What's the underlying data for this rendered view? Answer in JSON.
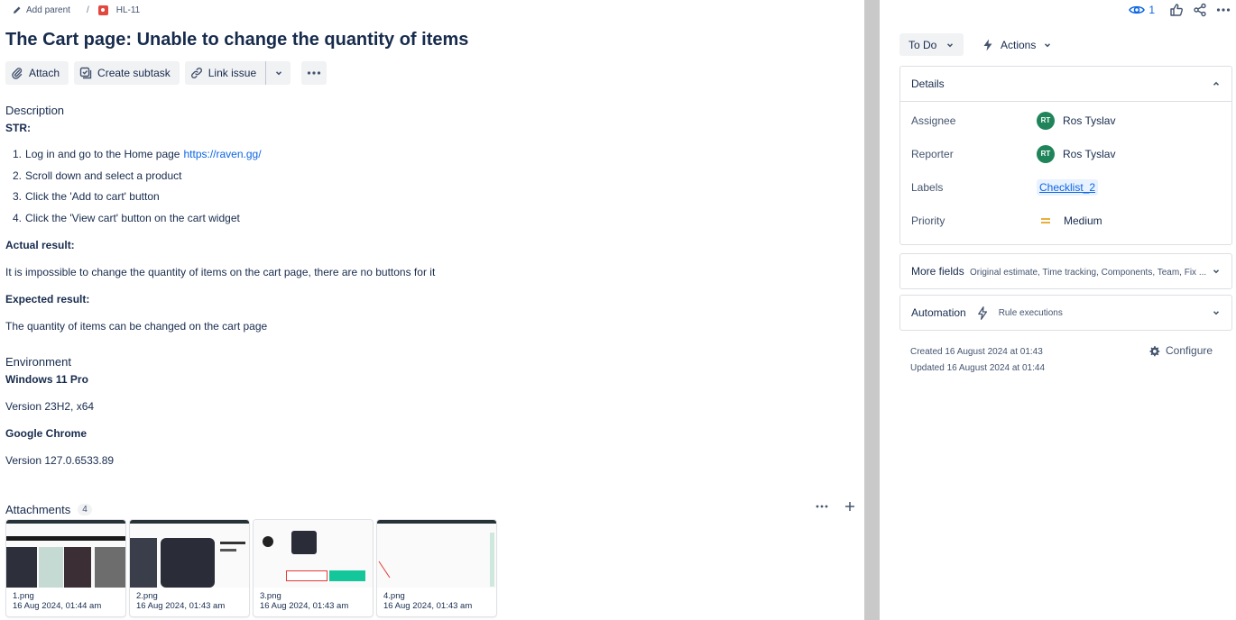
{
  "breadcrumb": {
    "add_parent": "Add parent",
    "separator": "/",
    "issue_key": "HL-11"
  },
  "issue": {
    "title": "The Cart page: Unable to change the quantity of items"
  },
  "toolbar": {
    "attach": "Attach",
    "create_subtask": "Create subtask",
    "link_issue": "Link issue"
  },
  "description": {
    "heading": "Description",
    "str_label": "STR:",
    "steps": [
      {
        "num": "1.",
        "text": "Log in and go to the Home page",
        "link": "https://raven.gg/"
      },
      {
        "num": "2.",
        "text": "Scroll down and select a product",
        "link": ""
      },
      {
        "num": "3.",
        "text": "Click the 'Add to cart' button",
        "link": ""
      },
      {
        "num": "4.",
        "text": "Click the 'View cart' button on the cart widget",
        "link": ""
      }
    ],
    "actual_label": "Actual result:",
    "actual_text": "It is impossible to change the quantity of items on the cart page, there are no buttons for it",
    "expected_label": "Expected result:",
    "expected_text": "The quantity of items can be changed on the cart page"
  },
  "environment": {
    "heading": "Environment",
    "os_label": "Windows 11 Pro",
    "os_version": "Version 23H2, x64",
    "browser_label": "Google Chrome",
    "browser_version": "Version 127.0.6533.89"
  },
  "attachments": {
    "heading": "Attachments",
    "count": "4",
    "items": [
      {
        "name": "1.png",
        "date": "16 Aug 2024, 01:44 am"
      },
      {
        "name": "2.png",
        "date": "16 Aug 2024, 01:43 am"
      },
      {
        "name": "3.png",
        "date": "16 Aug 2024, 01:43 am"
      },
      {
        "name": "4.png",
        "date": "16 Aug 2024, 01:43 am"
      }
    ]
  },
  "side": {
    "watchers": "1",
    "status": "To Do",
    "actions": "Actions",
    "details": {
      "heading": "Details",
      "assignee_label": "Assignee",
      "assignee_initials": "RT",
      "assignee_name": "Ros Tyslav",
      "reporter_label": "Reporter",
      "reporter_initials": "RT",
      "reporter_name": "Ros Tyslav",
      "labels_label": "Labels",
      "labels_value": "Checklist_2",
      "priority_label": "Priority",
      "priority_value": "Medium"
    },
    "more_fields": {
      "heading": "More fields",
      "summary": "Original estimate, Time tracking, Components, Team, Fix ..."
    },
    "automation": {
      "heading": "Automation",
      "summary": "Rule executions"
    },
    "created": "Created 16 August 2024 at 01:43",
    "updated": "Updated 16 August 2024 at 01:44",
    "configure": "Configure"
  },
  "colors": {
    "accent": "#0c66e4",
    "avatar": "#1f845a",
    "priority_medium": "#e2a51f",
    "issue_type_bug": "#e2483d"
  }
}
